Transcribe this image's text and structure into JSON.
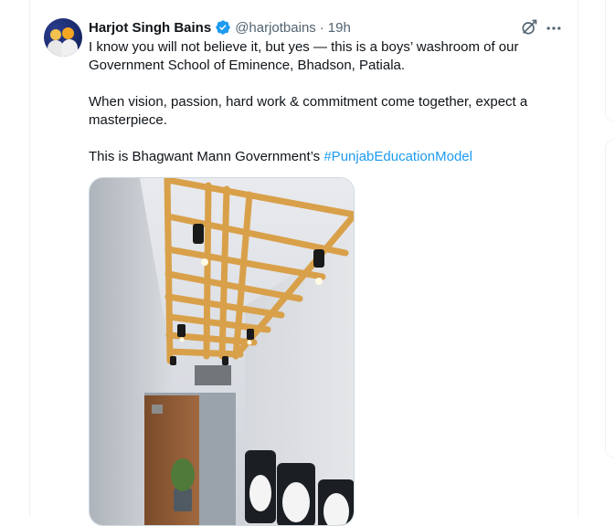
{
  "tweet": {
    "display_name": "Harjot Singh Bains",
    "handle": "@harjotbains",
    "separator": "·",
    "time": "19h",
    "text": {
      "line1": "I know you will not believe it, but yes — this is a boys’ washroom of our Government School of Eminence, Bhadson, Patiala.",
      "line2": "When vision, passion, hard work & commitment come together, expect a masterpiece.",
      "line3_prefix": "This is Bhagwant Mann Government’s ",
      "hashtag": "#PunjabEducationModel"
    },
    "media": {
      "type": "photo"
    }
  },
  "icons": {
    "verified": "verified-badge-icon",
    "grok": "grok-icon",
    "more": "more-options-icon"
  },
  "colors": {
    "accent": "#1d9bf0",
    "secondary_text": "#536471",
    "primary_text": "#0f1419"
  }
}
